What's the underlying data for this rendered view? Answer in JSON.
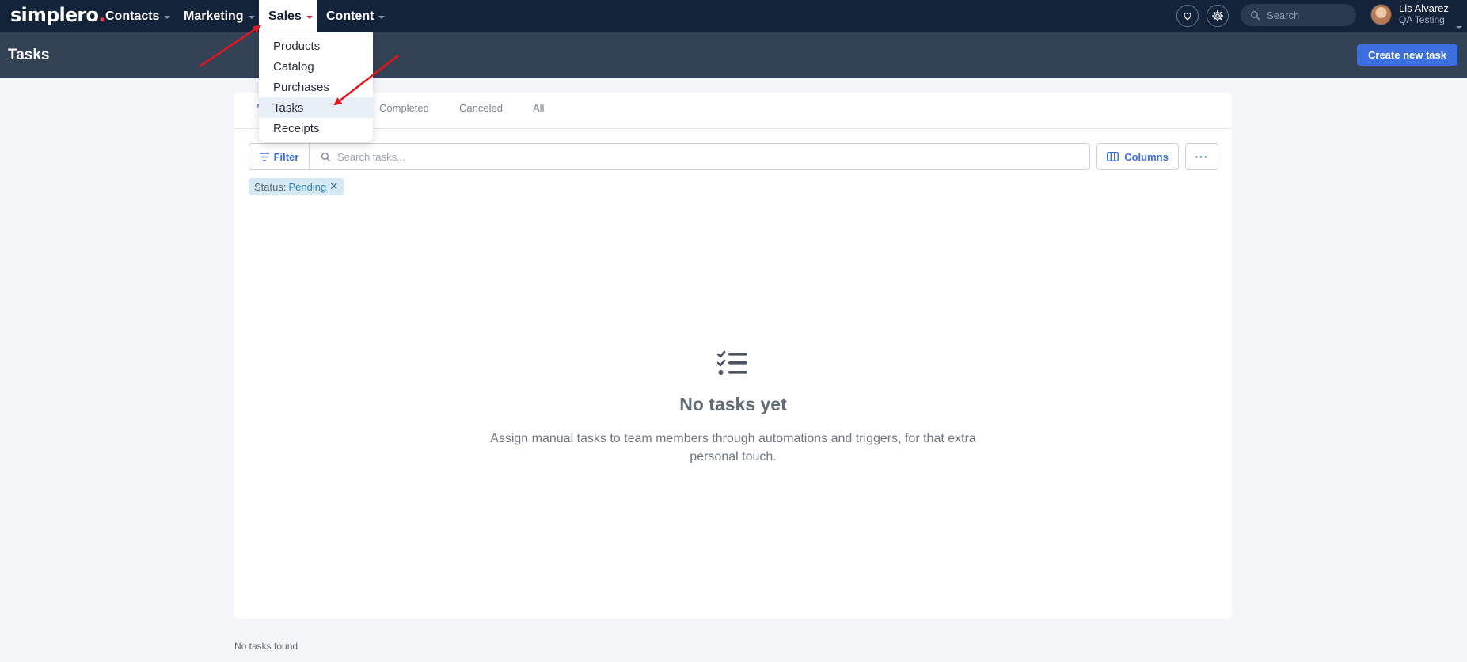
{
  "app": {
    "logo": "simplero",
    "logo_dot": "."
  },
  "nav": {
    "items": [
      {
        "label": "Contacts"
      },
      {
        "label": "Marketing"
      },
      {
        "label": "Sales"
      },
      {
        "label": "Content"
      }
    ],
    "active": "Sales"
  },
  "topbar": {
    "search_placeholder": "Search",
    "user_name": "Lis Alvarez",
    "user_org": "QA Testing",
    "icons": [
      "heart-icon",
      "gear-icon",
      "search-icon"
    ]
  },
  "header": {
    "title": "Tasks",
    "create_button": "Create new task"
  },
  "sales_menu": {
    "items": [
      {
        "label": "Products"
      },
      {
        "label": "Catalog"
      },
      {
        "label": "Purchases"
      },
      {
        "label": "Tasks"
      },
      {
        "label": "Receipts"
      }
    ],
    "highlighted": "Tasks"
  },
  "tabs": {
    "active_stub": "’",
    "items": [
      {
        "label": "Completed"
      },
      {
        "label": "Canceled"
      },
      {
        "label": "All"
      }
    ]
  },
  "toolbar": {
    "filter_label": "Filter",
    "search_placeholder": "Search tasks...",
    "columns_label": "Columns",
    "more_label": "···"
  },
  "active_filter": {
    "key": "Status:",
    "value": "Pending",
    "remove": "✕"
  },
  "empty_state": {
    "title": "No tasks yet",
    "description": "Assign manual tasks to team members through automations and triggers, for that extra personal touch."
  },
  "footer": {
    "note": "No tasks found"
  },
  "colors": {
    "topbar": "#13233a",
    "subheader": "#344256",
    "accent": "#3b6fe0",
    "annotation_arrow": "#e8141c"
  }
}
